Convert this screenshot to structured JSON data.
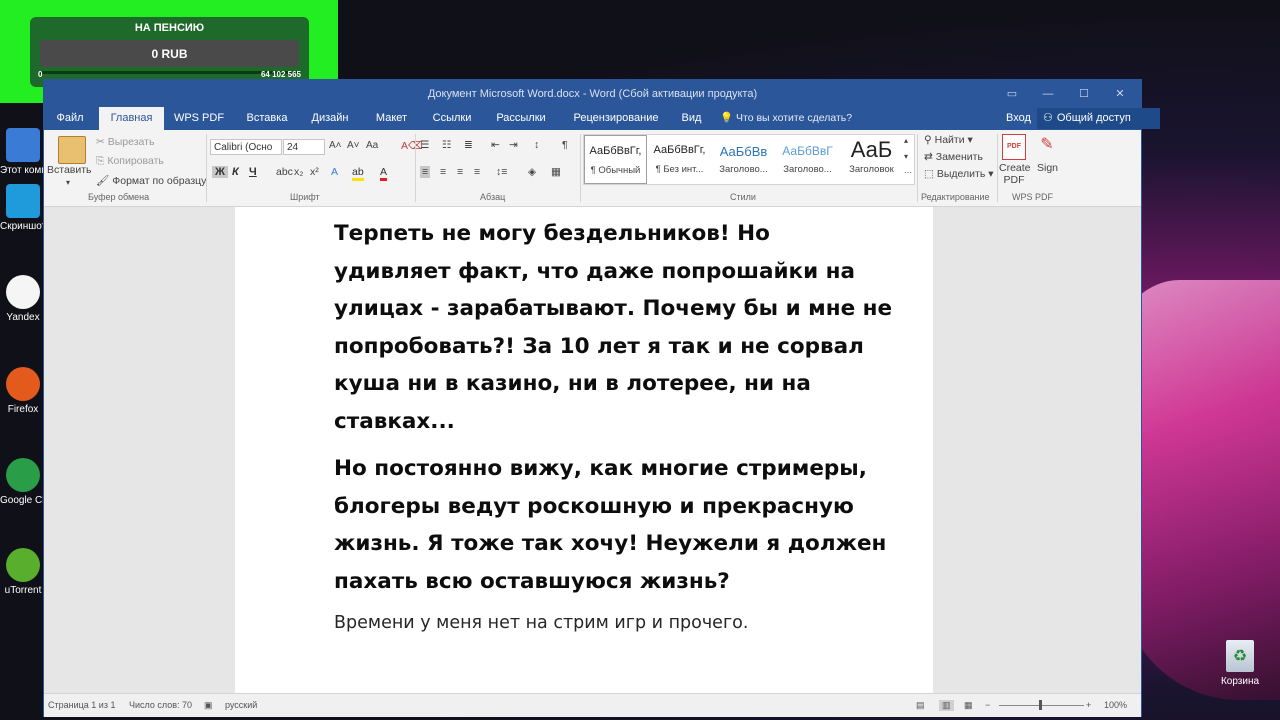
{
  "overlay": {
    "title": "НА ПЕНСИЮ",
    "amount": "0 RUB",
    "min": "0",
    "max": "64 102 565",
    "progress": 0
  },
  "desktop": {
    "icons": [
      {
        "label": "Этот компью...",
        "name": "this-pc-icon",
        "color": "#3a7bd5"
      },
      {
        "label": "Скриншоты",
        "name": "screenshots-icon",
        "color": "#1f9bdc"
      },
      {
        "label": "Yandex",
        "name": "yandex-icon",
        "color": "#f5f5f5"
      },
      {
        "label": "Firefox",
        "name": "firefox-icon",
        "color": "#e25a1c"
      },
      {
        "label": "Google Chrome",
        "name": "chrome-icon",
        "color": "#2a9d48"
      },
      {
        "label": "uTorrent",
        "name": "utorrent-icon",
        "color": "#5aae2e"
      }
    ],
    "recycle_label": "Корзина"
  },
  "window": {
    "title": "Документ Microsoft Word.docx - Word (Сбой активации продукта)"
  },
  "tabs": [
    "Файл",
    "Главная",
    "WPS PDF",
    "Вставка",
    "Дизайн",
    "Макет",
    "Ссылки",
    "Рассылки",
    "Рецензирование",
    "Вид"
  ],
  "active_tab": 1,
  "tellme": "Что вы хотите сделать?",
  "login": "Вход",
  "share": "Общий доступ",
  "ribbon": {
    "clipboard": {
      "paste": "Вставить",
      "cut": "Вырезать",
      "copy": "Копировать",
      "format_painter": "Формат по образцу",
      "label": "Буфер обмена"
    },
    "font": {
      "name": "Calibri (Осно",
      "size": "24",
      "bold": "Ж",
      "italic": "К",
      "underline": "Ч",
      "label": "Шрифт"
    },
    "paragraph": {
      "label": "Абзац"
    },
    "styles": {
      "label": "Стили",
      "items": [
        {
          "preview": "АаБбВвГг,",
          "name": "¶ Обычный"
        },
        {
          "preview": "АаБбВвГг,",
          "name": "¶ Без инт..."
        },
        {
          "preview": "АаБбВв",
          "name": "Заголово..."
        },
        {
          "preview": "АаБбВвГ",
          "name": "Заголово..."
        },
        {
          "preview": "АаБ",
          "name": "Заголовок"
        }
      ]
    },
    "editing": {
      "find": "Найти",
      "replace": "Заменить",
      "select": "Выделить",
      "label": "Редактирование"
    },
    "wps": {
      "create_pdf": "Create PDF",
      "sign": "Sign",
      "label": "WPS PDF"
    }
  },
  "document": {
    "paragraphs_bold": [
      "Терпеть не могу бездельников! Но удивляет факт, что даже попрошайки на улицах - зарабатывают. Почему бы и мне не попробовать?! За 10 лет я так и не сорвал куша ни в казино, ни в лотерее, ни на ставках...",
      "Но постоянно вижу, как многие стримеры, блогеры ведут роскошную и прекрасную жизнь. Я тоже так хочу! Неужели я должен пахать всю оставшуюся жизнь?"
    ],
    "paragraph_normal": "Времени у меня нет на стрим игр и прочего."
  },
  "status": {
    "page": "Страница 1 из 1",
    "words": "Число слов: 70",
    "language": "русский",
    "zoom": "100%"
  },
  "colors": {
    "accent": "#2b579a",
    "overlay_green": "#22ee22"
  }
}
